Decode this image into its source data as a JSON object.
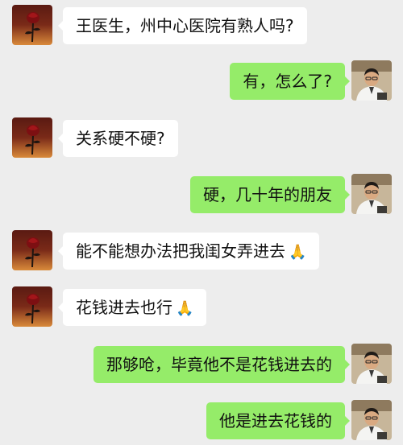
{
  "messages": [
    {
      "side": "left",
      "text": "王医生，州中心医院有熟人吗?",
      "emoji": ""
    },
    {
      "side": "right",
      "text": "有，怎么了?",
      "emoji": ""
    },
    {
      "side": "left",
      "text": "关系硬不硬?",
      "emoji": ""
    },
    {
      "side": "right",
      "text": "硬，几十年的朋友",
      "emoji": ""
    },
    {
      "side": "left",
      "text": "能不能想办法把我闺女弄进去",
      "emoji": "🙏"
    },
    {
      "side": "left",
      "text": "花钱进去也行",
      "emoji": "🙏"
    },
    {
      "side": "right",
      "text": "那够呛，毕竟他不是花钱进去的",
      "emoji": ""
    },
    {
      "side": "right",
      "text": "他是进去花钱的",
      "emoji": ""
    }
  ],
  "avatars": {
    "left": "rose-avatar-icon",
    "right": "doctor-avatar-icon"
  },
  "colors": {
    "background": "#ededed",
    "incoming_bubble": "#ffffff",
    "outgoing_bubble": "#95ec69",
    "text": "#111111"
  }
}
